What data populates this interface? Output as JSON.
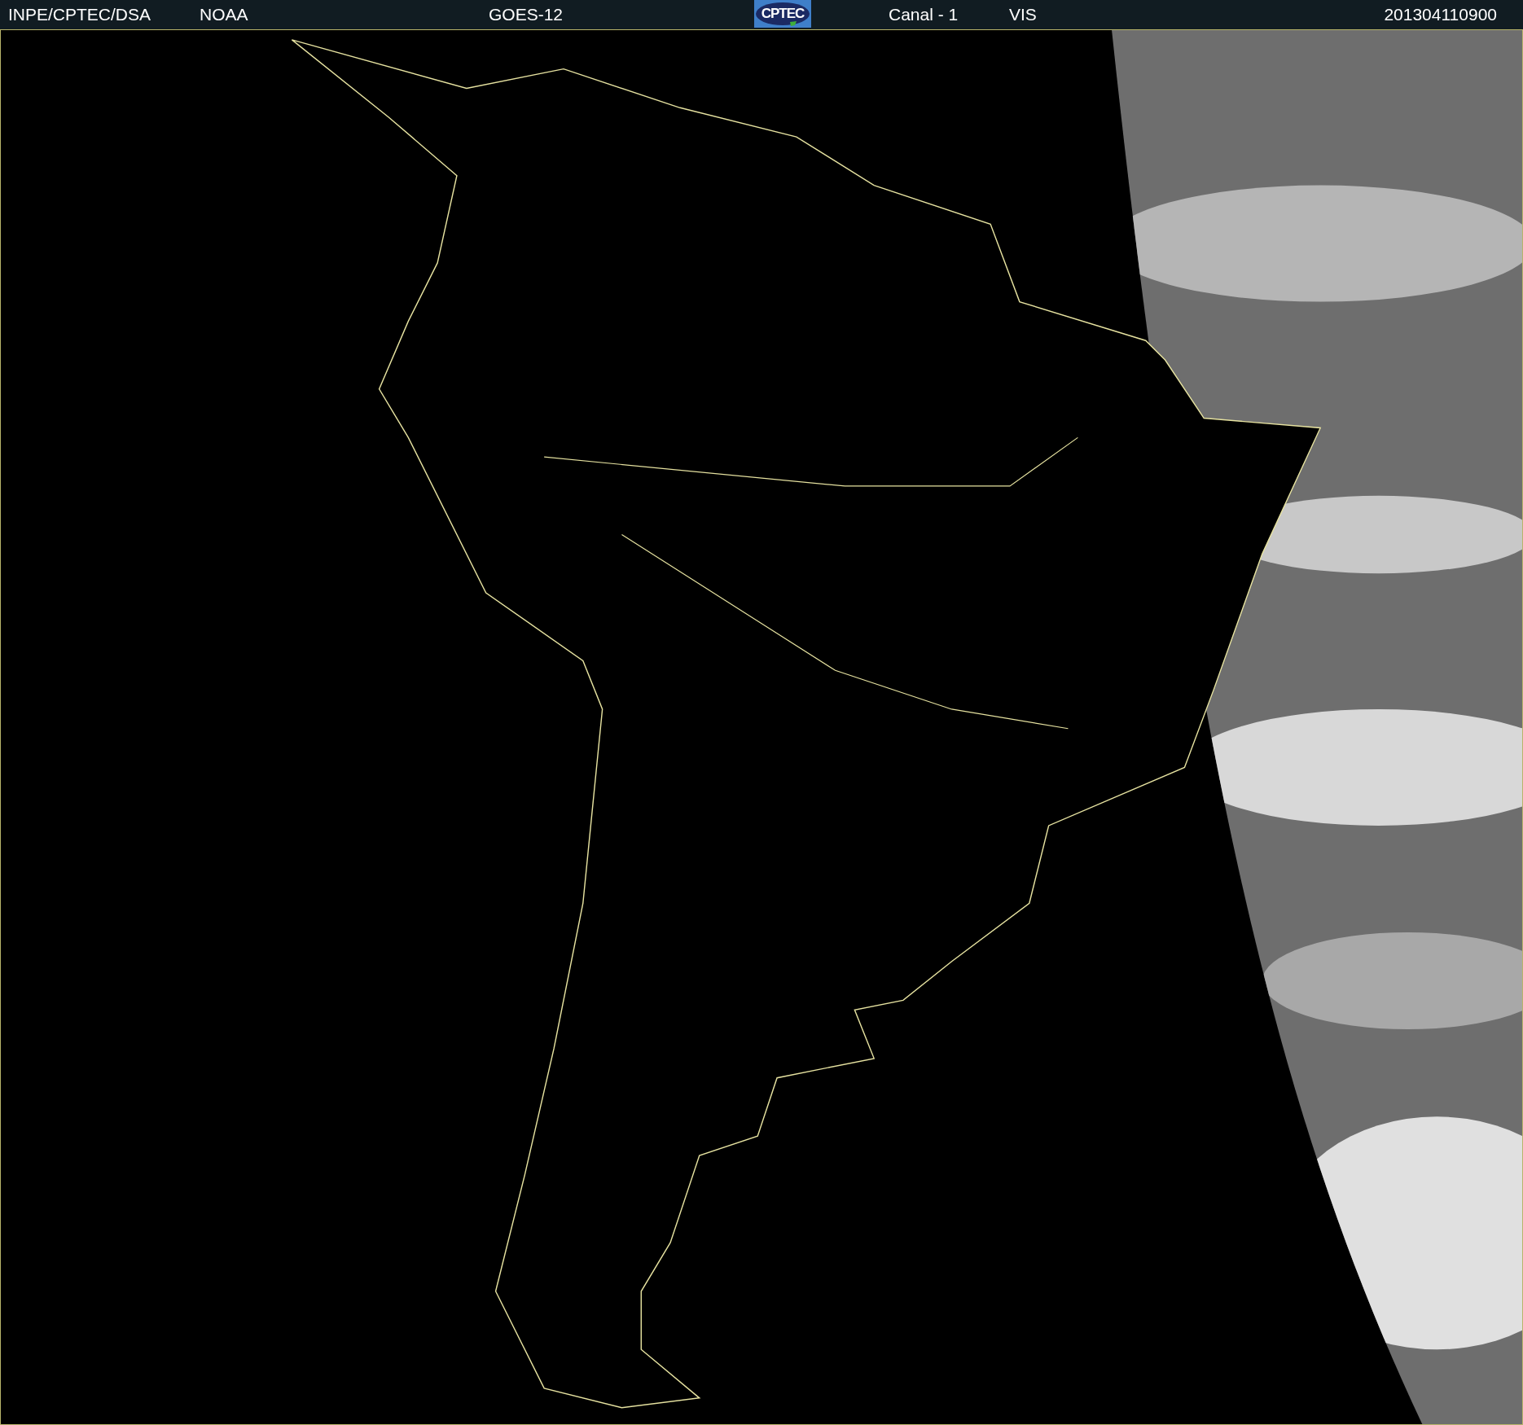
{
  "header": {
    "source": "INPE/CPTEC/DSA",
    "agency": "NOAA",
    "satellite": "GOES-12",
    "logo": "CPTEC",
    "channel": "Canal - 1",
    "band": "VIS",
    "timestamp": "201304110900"
  }
}
